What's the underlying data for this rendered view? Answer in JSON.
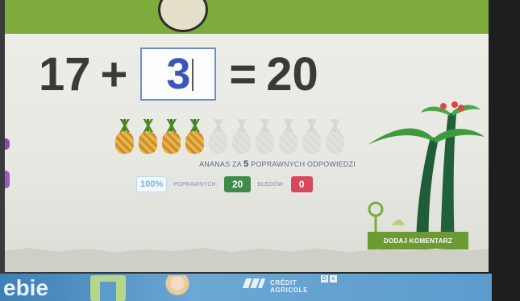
{
  "equation": {
    "left_operand": "17",
    "operator": "+",
    "answer": "3",
    "equals": "=",
    "result": "20"
  },
  "progress": {
    "earned_pineapples": 4,
    "total_pineapples": 10,
    "info_prefix": "ANANAS ZA",
    "info_count": "5",
    "info_suffix": "POPRAWNYCH ODPOWIEDZI"
  },
  "stats": {
    "percent": "100%",
    "correct_label": "POPRAWNYCH:",
    "correct_value": "20",
    "wrong_label": "BŁĘDÓW:",
    "wrong_value": "0"
  },
  "comment_button": {
    "label": "DODAJ KOMENTARZ"
  },
  "ad": {
    "text": "ebie",
    "brand_line1": "CRÉDIT",
    "brand_line2": "AGRICOLE",
    "close_label": "x",
    "info_label": "D"
  },
  "colors": {
    "header_green": "#7dab3c",
    "answer_blue": "#3d55b8",
    "correct_green": "#3e8b4a",
    "wrong_red": "#d8485b"
  }
}
